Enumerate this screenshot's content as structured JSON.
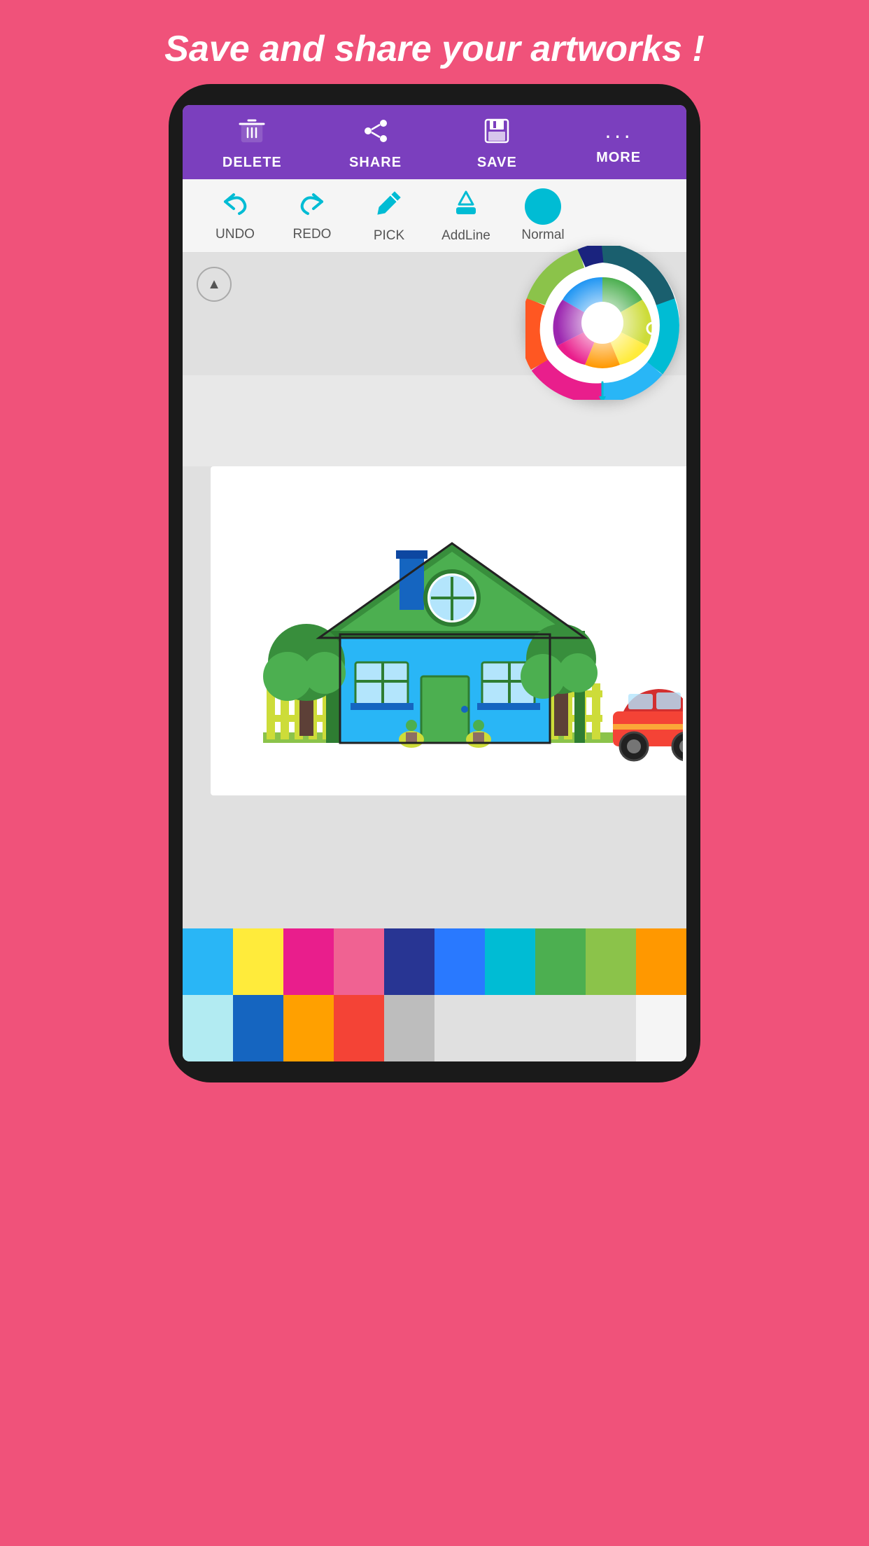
{
  "header": {
    "title": "Save and share your artworks !"
  },
  "toolbar": {
    "items": [
      {
        "id": "delete",
        "label": "DELETE",
        "icon": "🗑"
      },
      {
        "id": "share",
        "label": "SHARE",
        "icon": "🔗"
      },
      {
        "id": "save",
        "label": "SAVE",
        "icon": "💾"
      },
      {
        "id": "more",
        "label": "MORE",
        "icon": "···"
      }
    ]
  },
  "tools": {
    "items": [
      {
        "id": "undo",
        "label": "UNDO",
        "icon": "↩"
      },
      {
        "id": "redo",
        "label": "REDO",
        "icon": "↪"
      },
      {
        "id": "pick",
        "label": "PICK",
        "icon": "💉"
      },
      {
        "id": "addline",
        "label": "AddLine",
        "icon": "✏"
      },
      {
        "id": "normal",
        "label": "Normal",
        "icon": "circle"
      }
    ]
  },
  "colors": {
    "row1": [
      "#29B6F6",
      "#FFEB3B",
      "#E91E8C",
      "#F06292",
      "#283593",
      "#2979FF",
      "#00BCD4",
      "#4CAF50",
      "#8BC34A",
      "#FF9800"
    ],
    "row2": [
      "#B2EBF2",
      "#1565C0",
      "#FFA000",
      "#F44336",
      "#BDBDBD"
    ]
  },
  "accent_color": "#00BCD4",
  "toolbar_bg": "#7B3FBE"
}
